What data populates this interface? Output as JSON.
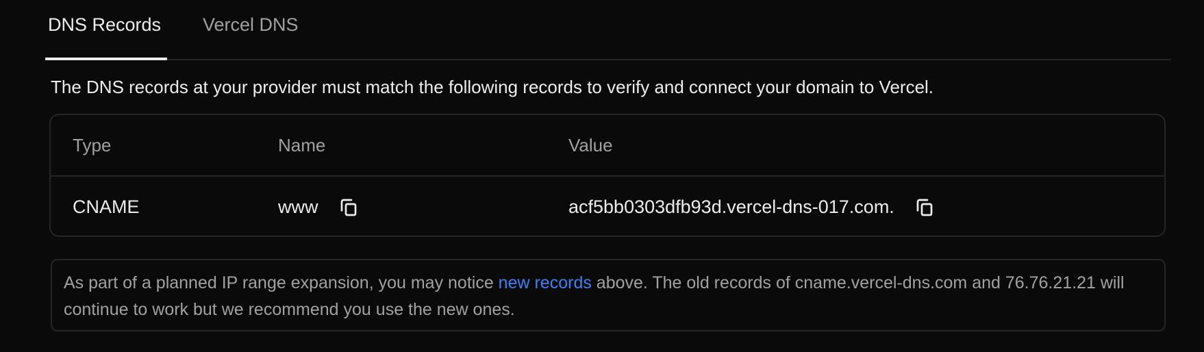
{
  "tabs": [
    {
      "label": "DNS Records",
      "active": true
    },
    {
      "label": "Vercel DNS",
      "active": false
    }
  ],
  "description": "The DNS records at your provider must match the following records to verify and connect your domain to Vercel.",
  "table": {
    "columns": [
      "Type",
      "Name",
      "Value"
    ],
    "rows": [
      {
        "type": "CNAME",
        "name": "www",
        "value": "acf5bb0303dfb93d.vercel-dns-017.com."
      }
    ]
  },
  "notice": {
    "text_before": "As part of a planned IP range expansion, you may notice ",
    "link_text": "new records",
    "text_after": " above. The old records of cname.vercel-dns.com and 76.76.21.21 will continue to work but we recommend you use the new ones."
  },
  "icons": {
    "copy": "copy-icon"
  },
  "colors": {
    "background": "#0a0a0a",
    "border": "#262626",
    "text_primary": "#ededed",
    "text_muted": "#a1a1a1",
    "link": "#3b82f6"
  }
}
